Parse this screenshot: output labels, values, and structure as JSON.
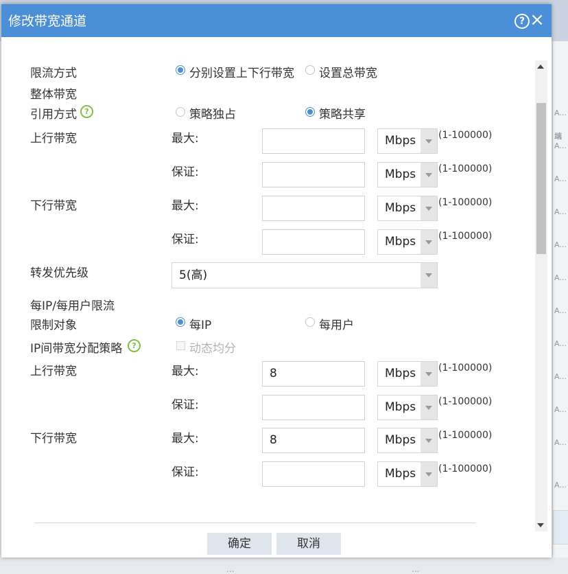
{
  "background": {
    "right_header": "端",
    "right_cells": [
      "A...",
      "A...",
      "A...",
      "A...",
      "A...",
      "A...",
      "A...",
      "A...",
      "A...",
      "A...",
      "A...",
      "A..."
    ],
    "bottom_text": [
      "...",
      "..."
    ]
  },
  "dialog": {
    "title": "修改带宽通道",
    "help_glyph": "?",
    "close_glyph": "×"
  },
  "colors": {
    "accent": "#4b8fd8",
    "help_icon": "#7cc241"
  },
  "form": {
    "limit_mode": {
      "label": "限流方式",
      "options": [
        "分别设置上下行带宽",
        "设置总带宽"
      ],
      "selected": 0
    },
    "overall_section": "整体带宽",
    "ref_mode": {
      "label": "引用方式",
      "options": [
        "策略独占",
        "策略共享"
      ],
      "selected": 1
    },
    "up_label": "上行带宽",
    "down_label": "下行带宽",
    "max_label": "最大:",
    "guarantee_label": "保证:",
    "unit": "Mbps",
    "range": "(1-100000)",
    "overall_values": {
      "up_max": "",
      "up_guarantee": "",
      "down_max": "",
      "down_guarantee": ""
    },
    "priority": {
      "label": "转发优先级",
      "value": "5(高)"
    },
    "per_ip_section": "每IP/每用户限流",
    "limit_target": {
      "label": "限制对象",
      "options": [
        "每IP",
        "每用户"
      ],
      "selected": 0
    },
    "ip_policy": {
      "label": "IP间带宽分配策略",
      "checkbox_label": "动态均分",
      "checked": false,
      "disabled": true
    },
    "per_values": {
      "up_max": "8",
      "up_guarantee": "",
      "down_max": "8",
      "down_guarantee": ""
    }
  },
  "buttons": {
    "ok": "确定",
    "cancel": "取消"
  }
}
